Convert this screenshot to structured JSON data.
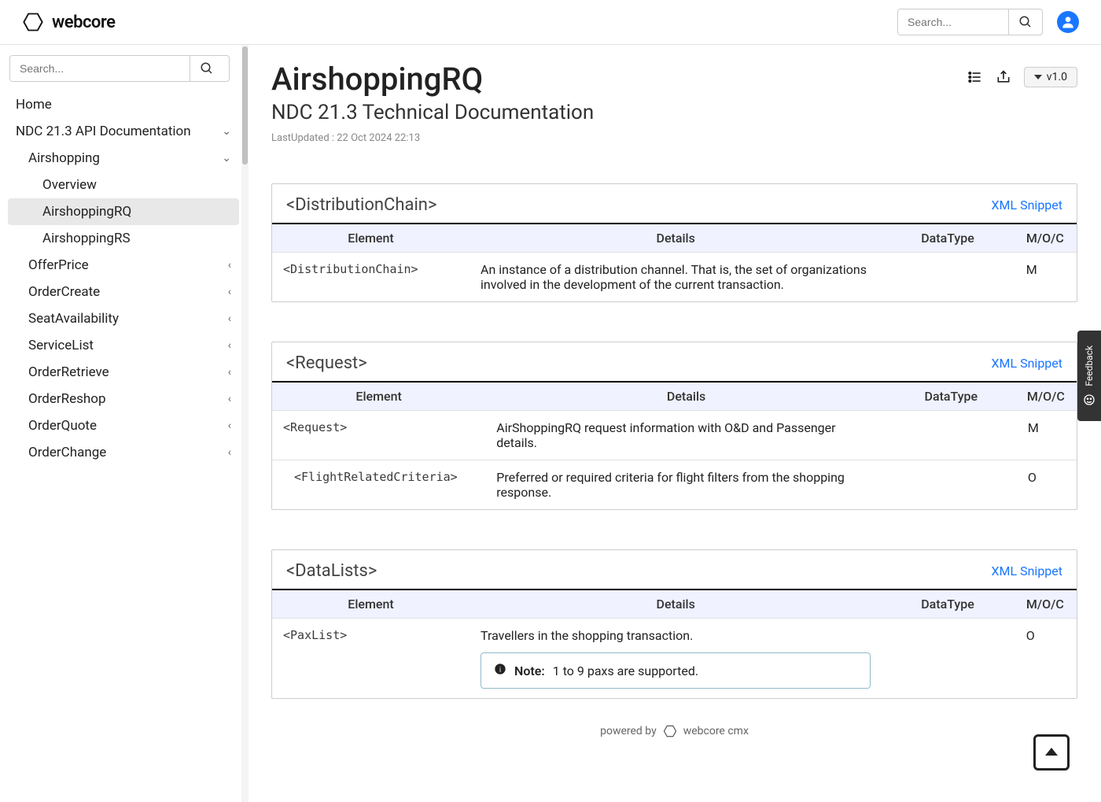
{
  "brand": {
    "name": "webcore"
  },
  "search": {
    "placeholder": "Search..."
  },
  "sidebar": {
    "search_placeholder": "Search...",
    "items": [
      {
        "label": "Home",
        "indent": 0,
        "chev": ""
      },
      {
        "label": "NDC 21.3 API Documentation",
        "indent": 0,
        "chev": "down"
      },
      {
        "label": "Airshopping",
        "indent": 1,
        "chev": "down"
      },
      {
        "label": "Overview",
        "indent": 2,
        "chev": ""
      },
      {
        "label": "AirshoppingRQ",
        "indent": 2,
        "chev": "",
        "active": true
      },
      {
        "label": "AirshoppingRS",
        "indent": 2,
        "chev": ""
      },
      {
        "label": "OfferPrice",
        "indent": 1,
        "chev": "left"
      },
      {
        "label": "OrderCreate",
        "indent": 1,
        "chev": "left"
      },
      {
        "label": "SeatAvailability",
        "indent": 1,
        "chev": "left"
      },
      {
        "label": "ServiceList",
        "indent": 1,
        "chev": "left"
      },
      {
        "label": "OrderRetrieve",
        "indent": 1,
        "chev": "left"
      },
      {
        "label": "OrderReshop",
        "indent": 1,
        "chev": "left"
      },
      {
        "label": "OrderQuote",
        "indent": 1,
        "chev": "left"
      },
      {
        "label": "OrderChange",
        "indent": 1,
        "chev": "left"
      }
    ]
  },
  "page": {
    "title": "AirshoppingRQ",
    "subtitle": "NDC 21.3 Technical Documentation",
    "last_updated": "LastUpdated : 22 Oct 2024 22:13",
    "version": "v1.0"
  },
  "table_headers": {
    "element": "Element",
    "details": "Details",
    "datatype": "DataType",
    "moc": "M/O/C"
  },
  "xml_snippet_label": "XML Snippet",
  "sections": [
    {
      "title": "<DistributionChain>",
      "rows": [
        {
          "element": "<DistributionChain>",
          "indent": 0,
          "details": "An instance of a distribution channel. That is, the set of organizations involved in the development of the current transaction.",
          "datatype": "",
          "flag": "M"
        }
      ]
    },
    {
      "title": "<Request>",
      "rows": [
        {
          "element": "<Request>",
          "indent": 0,
          "details": "AirShoppingRQ request information with O&D and Passenger details.",
          "datatype": "",
          "flag": "M"
        },
        {
          "element": "<FlightRelatedCriteria>",
          "indent": 1,
          "details": "Preferred or required criteria for flight filters from the shopping response.",
          "datatype": "",
          "flag": "O"
        }
      ]
    },
    {
      "title": "<DataLists>",
      "rows": [
        {
          "element": "<PaxList>",
          "indent": 0,
          "details": "Travellers in the shopping transaction.",
          "datatype": "",
          "flag": "O",
          "note": {
            "label": "Note:",
            "text": "1 to 9 paxs are supported."
          }
        }
      ]
    }
  ],
  "footer": {
    "powered_by": "powered by",
    "product": "webcore cmx"
  },
  "feedback_label": "Feedback"
}
